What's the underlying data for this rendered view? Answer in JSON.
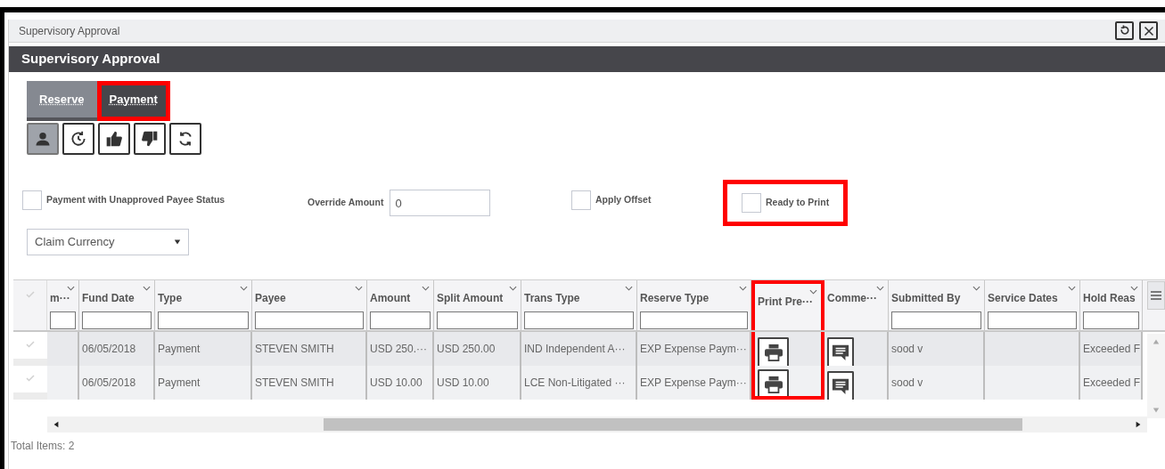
{
  "window": {
    "title": "Supervisory Approval"
  },
  "header": {
    "title": "Supervisory Approval"
  },
  "tabs": [
    {
      "label": "Reserve",
      "selected": false,
      "highlighted": false
    },
    {
      "label": "Payment",
      "selected": true,
      "highlighted": true
    }
  ],
  "toolbar": [
    {
      "kind": "person",
      "selected": true
    },
    {
      "kind": "history",
      "selected": false
    },
    {
      "kind": "approve",
      "selected": false
    },
    {
      "kind": "reject",
      "selected": false
    },
    {
      "kind": "refresh",
      "selected": false
    }
  ],
  "options": [
    {
      "kind": "checkbox",
      "label": "Payment with Unapproved Payee Status",
      "checked": false,
      "highlighted": false
    },
    {
      "kind": "input",
      "label": "Override Amount",
      "value": "0"
    },
    {
      "kind": "checkbox",
      "label": "Apply Offset",
      "checked": false,
      "highlighted": false
    },
    {
      "kind": "checkbox",
      "label": "Ready to Print",
      "checked": false,
      "highlighted": true
    }
  ],
  "currency_select": {
    "value": "Claim Currency"
  },
  "table": {
    "columns": [
      {
        "label": "m···",
        "filter": true,
        "highlighted": false
      },
      {
        "label": "Fund Date",
        "filter": true,
        "highlighted": false
      },
      {
        "label": "Type",
        "filter": true,
        "highlighted": false
      },
      {
        "label": "Payee",
        "filter": true,
        "highlighted": false
      },
      {
        "label": "Amount",
        "filter": true,
        "highlighted": false
      },
      {
        "label": "Split Amount",
        "filter": true,
        "highlighted": false
      },
      {
        "label": "Trans Type",
        "filter": true,
        "highlighted": false
      },
      {
        "label": "Reserve Type",
        "filter": true,
        "highlighted": false
      },
      {
        "label": "Print Pre···",
        "filter": false,
        "highlighted": true
      },
      {
        "label": "Comme···",
        "filter": false,
        "highlighted": false
      },
      {
        "label": "Submitted By",
        "filter": true,
        "highlighted": false
      },
      {
        "label": "Service Dates",
        "filter": true,
        "highlighted": false
      },
      {
        "label": "Hold Reas",
        "filter": true,
        "highlighted": false
      }
    ],
    "rows": [
      {
        "selected": false,
        "cells": [
          {
            "kind": "text",
            "text": ""
          },
          {
            "kind": "text",
            "text": "06/05/2018"
          },
          {
            "kind": "text",
            "text": "Payment"
          },
          {
            "kind": "text",
            "text": "STEVEN SMITH"
          },
          {
            "kind": "text",
            "text": "USD 250.···"
          },
          {
            "kind": "text",
            "text": "USD 250.00"
          },
          {
            "kind": "text",
            "text": "IND Independent A···"
          },
          {
            "kind": "text",
            "text": "EXP Expense Paym···"
          },
          {
            "kind": "print"
          },
          {
            "kind": "comment"
          },
          {
            "kind": "text",
            "text": "sood v"
          },
          {
            "kind": "text",
            "text": ""
          },
          {
            "kind": "text",
            "text": "Exceeded F"
          }
        ]
      },
      {
        "selected": false,
        "cells": [
          {
            "kind": "text",
            "text": ""
          },
          {
            "kind": "text",
            "text": "06/05/2018"
          },
          {
            "kind": "text",
            "text": "Payment"
          },
          {
            "kind": "text",
            "text": "STEVEN SMITH"
          },
          {
            "kind": "text",
            "text": "USD 10.00"
          },
          {
            "kind": "text",
            "text": "USD 10.00"
          },
          {
            "kind": "text",
            "text": "LCE Non-Litigated ···"
          },
          {
            "kind": "text",
            "text": "EXP Expense Paym···"
          },
          {
            "kind": "print"
          },
          {
            "kind": "comment"
          },
          {
            "kind": "text",
            "text": "sood v"
          },
          {
            "kind": "text",
            "text": ""
          },
          {
            "kind": "text",
            "text": "Exceeded F"
          }
        ]
      }
    ]
  },
  "status_bar": {
    "text": "Total Items: 2"
  }
}
